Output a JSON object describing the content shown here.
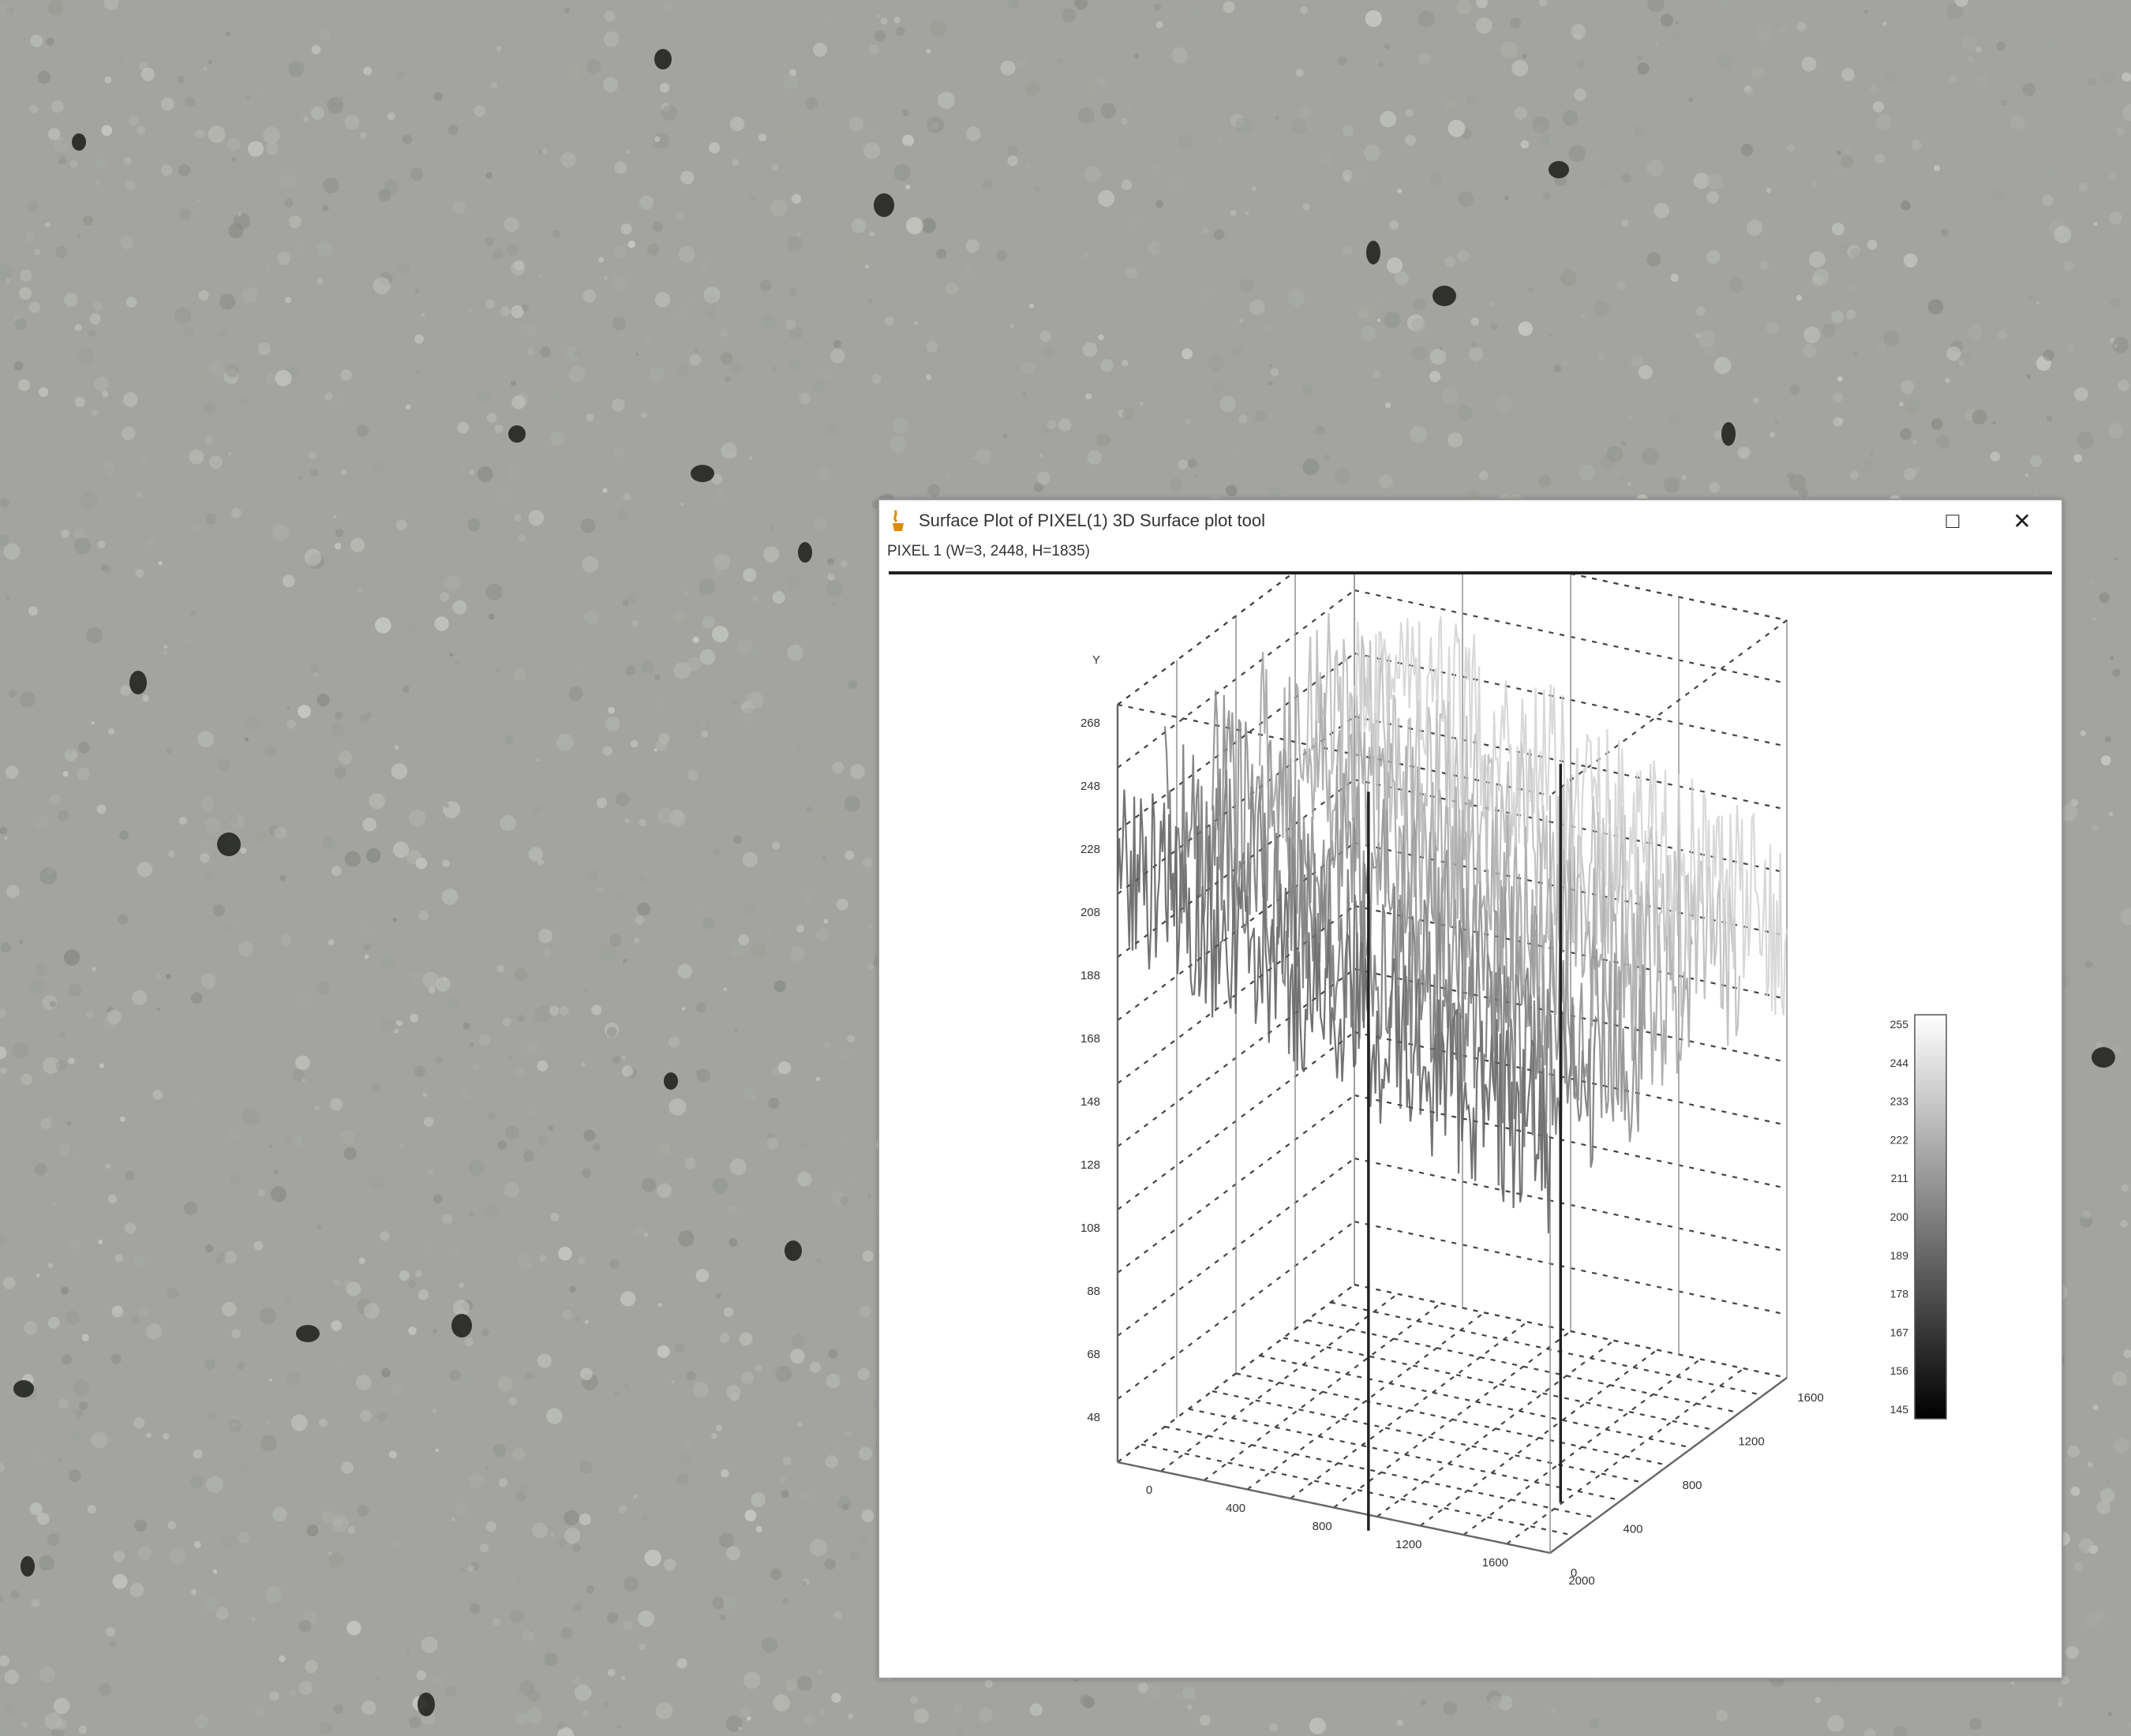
{
  "window": {
    "title": "Surface Plot of PIXEL(1) 3D Surface plot tool",
    "status_text": "PIXEL 1 (W=3, 2448, H=1835)",
    "maximize_icon": "maximize-icon",
    "close_icon": "close-icon"
  },
  "chart_data": {
    "type": "surface",
    "title": "",
    "xlabel": "",
    "ylabel": "",
    "zlabel": "",
    "z_ticks": [
      "Y",
      "268",
      "248",
      "228",
      "208",
      "188",
      "168",
      "148",
      "128",
      "108",
      "88",
      "68",
      "48"
    ],
    "x_ticks": [
      "0",
      "400",
      "800",
      "1200",
      "1600",
      "2000"
    ],
    "y_ticks": [
      "0",
      "400",
      "800",
      "1200",
      "1600"
    ],
    "zlim": [
      48,
      268
    ],
    "colorbar": {
      "ticks": [
        "255",
        "244",
        "233",
        "222",
        "211",
        "200",
        "189",
        "178",
        "167",
        "156",
        "145"
      ],
      "low_color": "#000000",
      "high_color": "#ffffff"
    },
    "grid": true,
    "colormap": "grayscale",
    "description_profile": "surface intensity declines from about 220 at the back-left to about 170 at the front-right, with two deep spikes near the right side"
  }
}
